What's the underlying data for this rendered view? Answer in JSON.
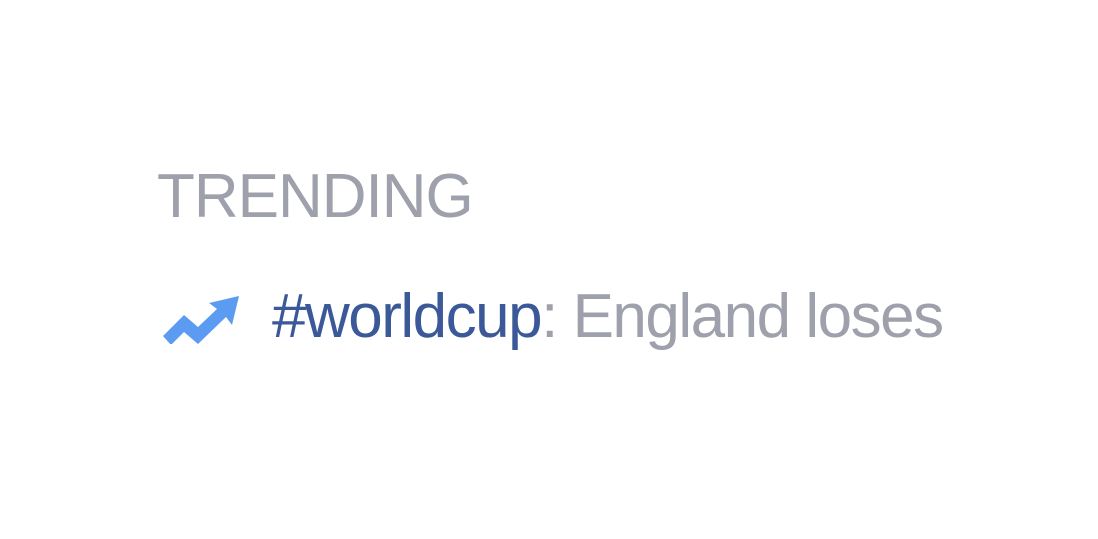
{
  "trending": {
    "heading": "TRENDING",
    "items": [
      {
        "icon": "trending-up-icon",
        "hashtag": "#worldcup",
        "separator": ":",
        "headline": " England loses"
      }
    ]
  },
  "colors": {
    "heading": "#9ea1ab",
    "hashtag": "#3b5998",
    "icon": "#5b9cf2",
    "background": "#ffffff"
  }
}
